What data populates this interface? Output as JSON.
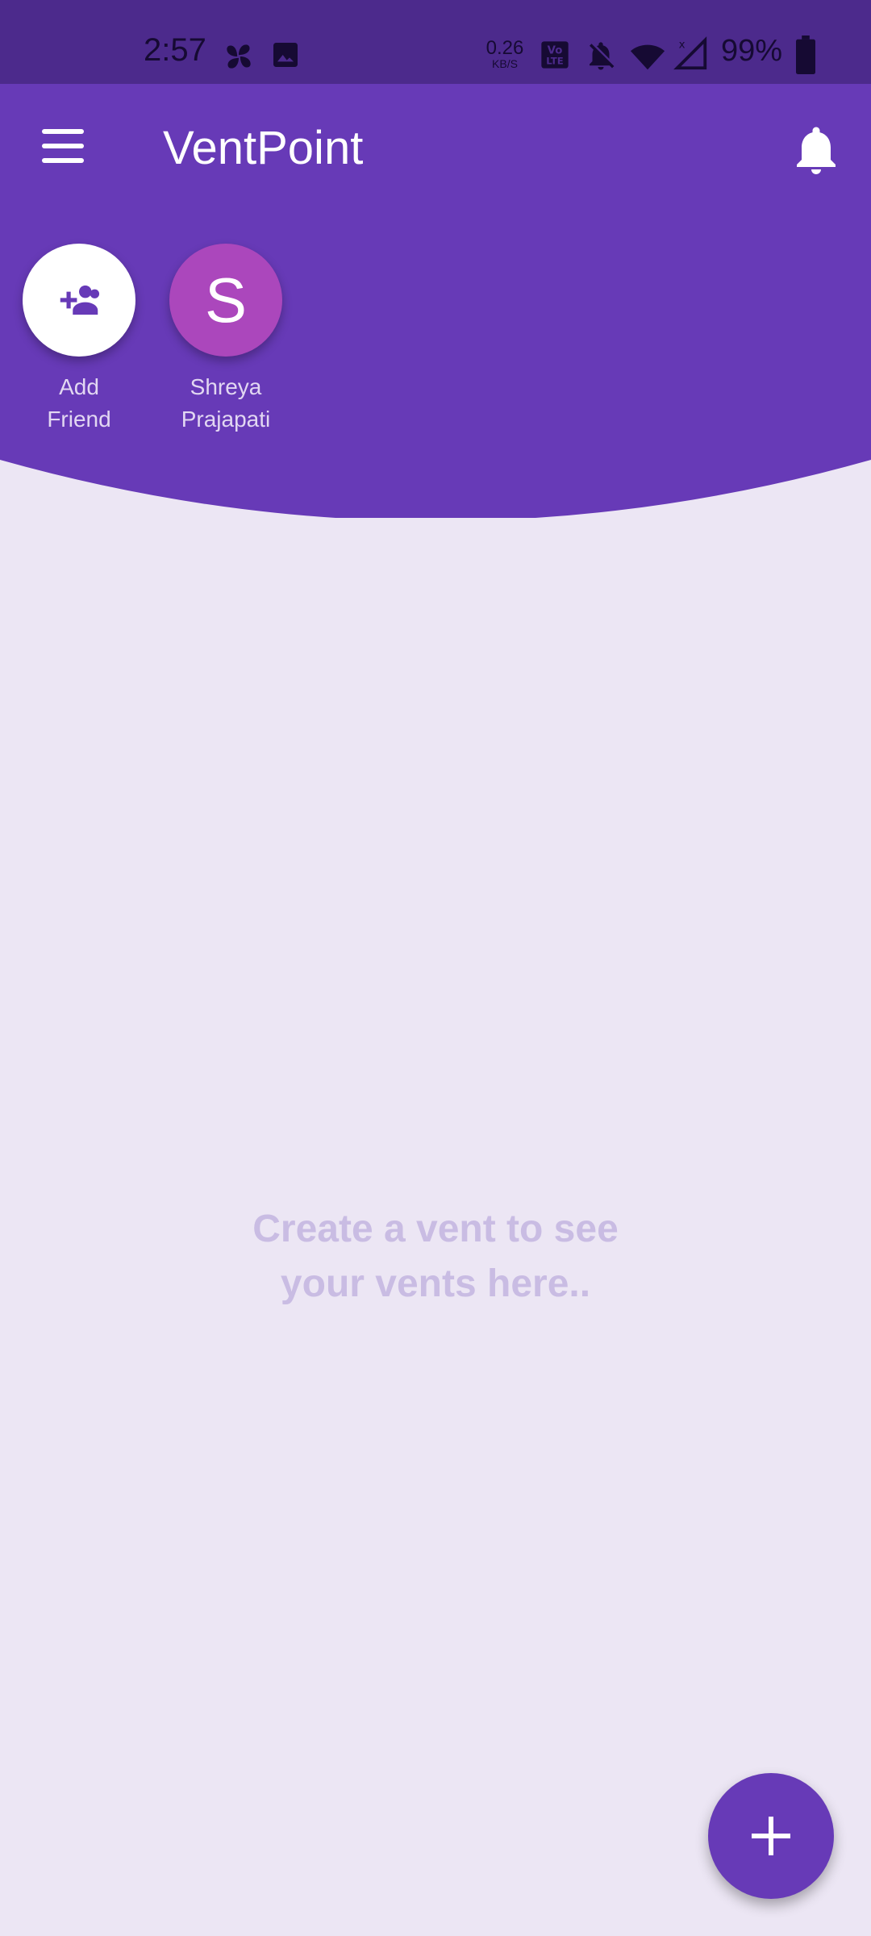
{
  "status_bar": {
    "time": "2:57",
    "net_speed_value": "0.26",
    "net_speed_unit": "KB/S",
    "battery_pct": "99%",
    "icons": [
      "pinwheel-icon",
      "image-icon",
      "volte-icon",
      "bell-off-icon",
      "wifi-icon",
      "signal-icon",
      "battery-icon"
    ]
  },
  "app_bar": {
    "title": "VentPoint",
    "menu_icon": "hamburger-menu-icon",
    "notifications_icon": "bell-icon"
  },
  "friends": [
    {
      "label_line1": "Add",
      "label_line2": "Friend",
      "icon": "add-friend-icon"
    },
    {
      "initial": "S",
      "label_line1": "Shreya",
      "label_line2": "Prajapati"
    }
  ],
  "empty_state": {
    "line1": "Create a vent to see",
    "line2": "your vents here.."
  },
  "fab": {
    "icon": "plus-icon"
  },
  "colors": {
    "primary": "#673AB7",
    "status_bar": "#4C2A8C",
    "background": "#ECE6F4",
    "avatar": "#AB47BC",
    "empty_text": "#C9BCE3"
  }
}
